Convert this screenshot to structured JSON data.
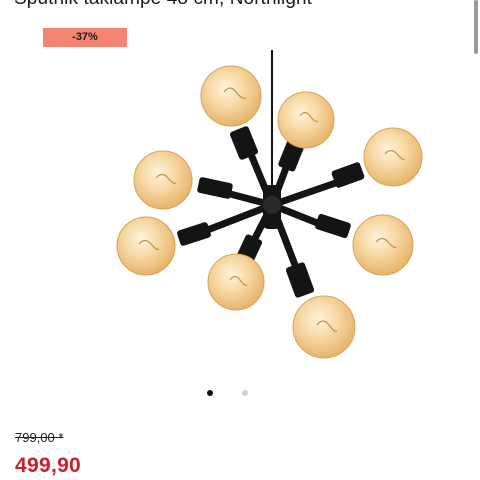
{
  "product": {
    "title": "Sputnik taklampe 48 cm, Northlight",
    "discount_badge": "-37%",
    "old_price": "799,00 *",
    "price": "499,90",
    "image_icon": "pendant-lamp-image"
  },
  "carousel": {
    "dots": [
      "active",
      "inactive"
    ]
  },
  "colors": {
    "badge": "#f48473",
    "price": "#c8202c",
    "lamp_frame": "#141414",
    "bulb": "#f5c98a"
  }
}
